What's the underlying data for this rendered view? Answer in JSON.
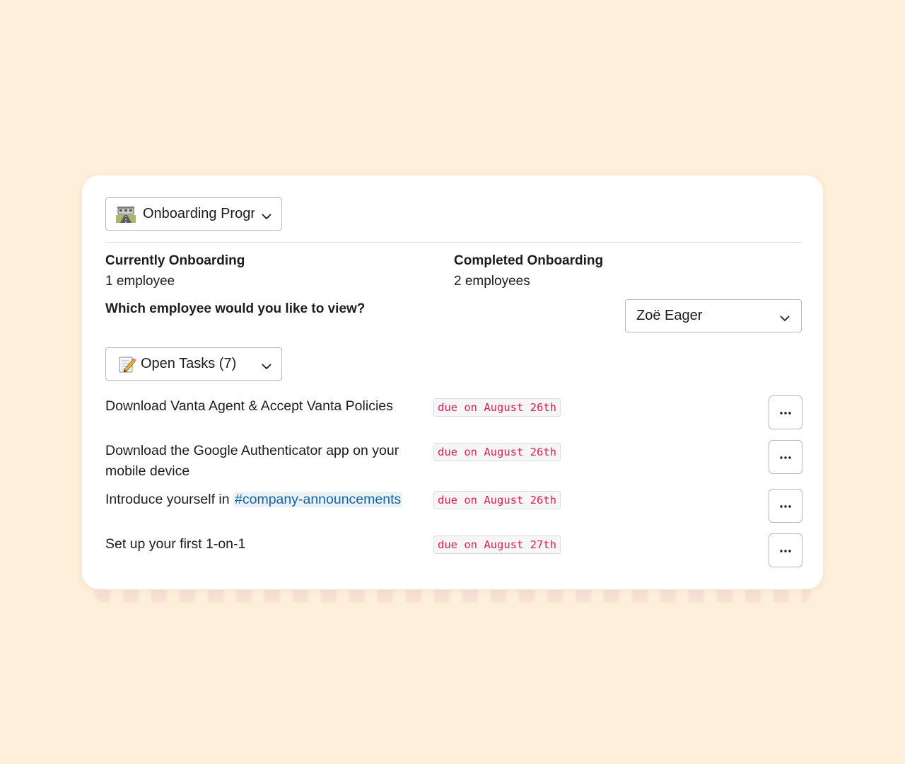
{
  "program_select": {
    "label": "Onboarding Progr",
    "icon": "railway-icon"
  },
  "stats": {
    "current_title": "Currently Onboarding",
    "current_value": "1 employee",
    "completed_title": "Completed Onboarding",
    "completed_value": "2 employees"
  },
  "employee_picker": {
    "question": "Which employee would you like to view?",
    "selected": "Zoë Eager"
  },
  "tasks_select": {
    "label": "Open Tasks (7)",
    "icon": "memo-icon"
  },
  "tasks": [
    {
      "title": "Download Vanta Agent & Accept Vanta Policies",
      "due": "due on August 26th"
    },
    {
      "title": "Download the Google Authenticator app on your mobile device",
      "due": "due on August 26th"
    },
    {
      "title_prefix": "Introduce yourself in ",
      "channel": "#company-announcements",
      "due": "due on August 26th"
    },
    {
      "title": "Set up your first 1-on-1",
      "due": "due on August 27th"
    }
  ],
  "more_label": "···",
  "colors": {
    "background": "#fdefd9",
    "card": "#ffffff",
    "due_text": "#e01e5a",
    "channel_link": "#1264a3"
  }
}
